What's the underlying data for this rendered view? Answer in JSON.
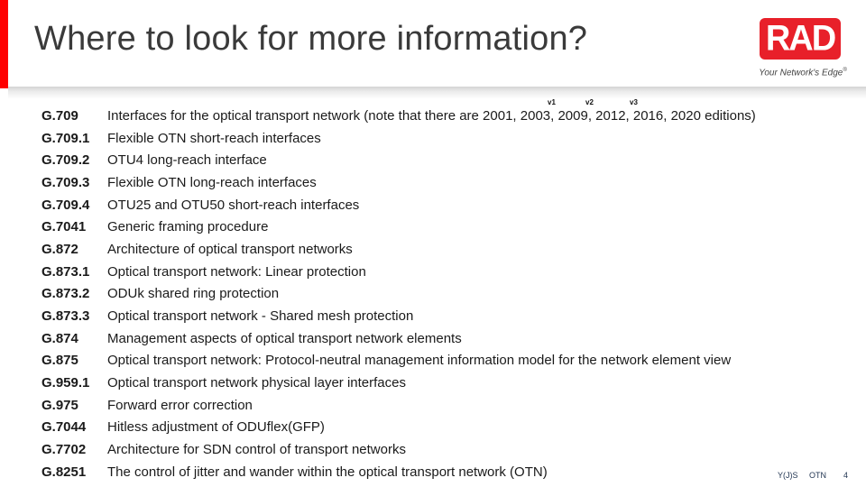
{
  "header": {
    "title": "Where to look for more information?",
    "accent_color": "#ff0000"
  },
  "logo": {
    "text": "RAD",
    "tagline": "Your Network's Edge",
    "tagline_mark": "®",
    "color": "#e8202a"
  },
  "version_labels": [
    "v1",
    "v2",
    "v3"
  ],
  "standards": [
    {
      "code": "G.709",
      "description": "Interfaces for the optical transport network (note that there are 2001, 2003, 2009, 2012, 2016, 2020 editions)"
    },
    {
      "code": "G.709.1",
      "description": "Flexible OTN short-reach interfaces"
    },
    {
      "code": "G.709.2",
      "description": "OTU4 long-reach interface"
    },
    {
      "code": "G.709.3",
      "description": "Flexible OTN long-reach interfaces"
    },
    {
      "code": "G.709.4",
      "description": "OTU25 and OTU50 short-reach interfaces"
    },
    {
      "code": "G.7041",
      "description": "Generic framing procedure"
    },
    {
      "code": "G.872",
      "description": "Architecture of optical transport networks"
    },
    {
      "code": "G.873.1",
      "description": "Optical transport network: Linear protection"
    },
    {
      "code": "G.873.2",
      "description": "ODUk shared ring protection"
    },
    {
      "code": "G.873.3",
      "description": "Optical transport network - Shared mesh protection"
    },
    {
      "code": "G.874",
      "description": "Management aspects of optical transport network elements"
    },
    {
      "code": "G.875",
      "description": "Optical transport network: Protocol-neutral management information model for the network element view"
    },
    {
      "code": "G.959.1",
      "description": "Optical transport network physical layer interfaces"
    },
    {
      "code": "G.975",
      "description": "Forward error correction"
    },
    {
      "code": "G.7044",
      "description": "Hitless adjustment of ODUflex(GFP)"
    },
    {
      "code": "G.7702",
      "description": "Architecture for SDN control of transport networks"
    },
    {
      "code": "G.8251",
      "description": "The control of jitter and wander within the optical transport network (OTN)"
    }
  ],
  "footer": {
    "author": "Y(J)S",
    "topic": "OTN",
    "page_number": "4"
  }
}
